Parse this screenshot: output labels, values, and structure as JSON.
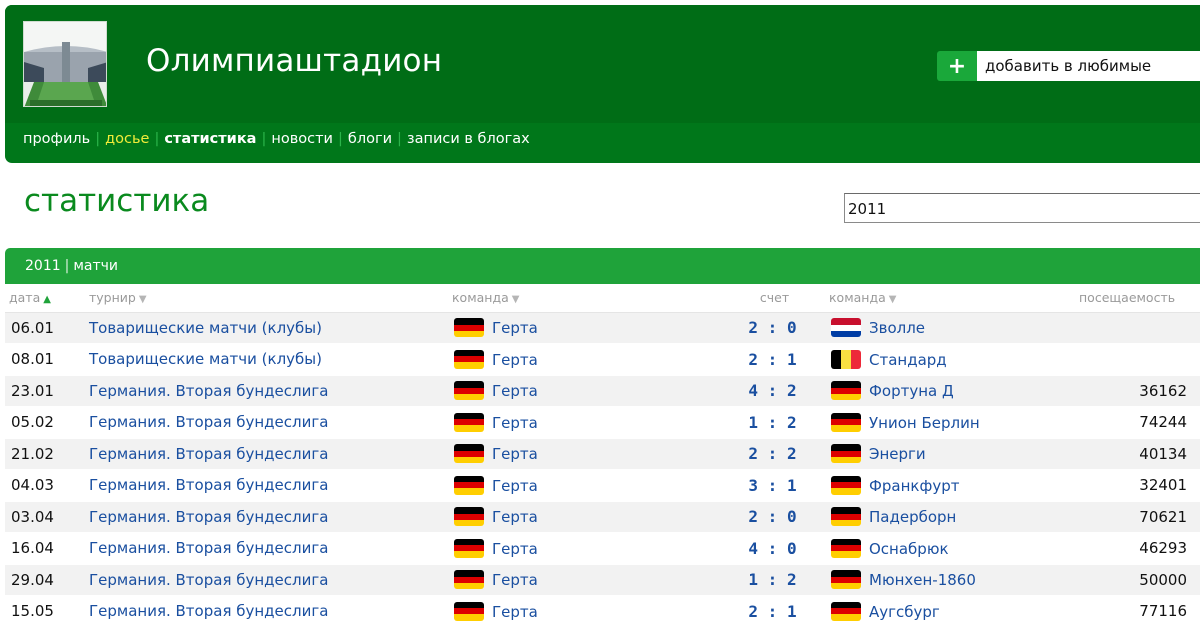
{
  "header": {
    "title": "Олимпиаштадион",
    "favorite_plus": "+",
    "favorite_label": "добавить в любимые"
  },
  "nav": [
    {
      "label": "профиль",
      "state": "normal"
    },
    {
      "label": "досье",
      "state": "highlight"
    },
    {
      "label": "статистика",
      "state": "current"
    },
    {
      "label": "новости",
      "state": "normal"
    },
    {
      "label": "блоги",
      "state": "normal"
    },
    {
      "label": "записи в блогах",
      "state": "normal"
    }
  ],
  "page_title": "статистика",
  "year_select": {
    "value": "2011"
  },
  "table": {
    "caption_year": "2011",
    "caption_sep": "|",
    "caption_section": "матчи",
    "columns": [
      "дата",
      "турнир",
      "команда",
      "счет",
      "команда",
      "посещаемость"
    ],
    "rows": [
      {
        "date": "06.01",
        "tournament": "Товарищеские матчи (клубы)",
        "home": "Герта",
        "home_flag": "de",
        "score": "2 : 0",
        "away": "Зволле",
        "away_flag": "nl",
        "attendance": ""
      },
      {
        "date": "08.01",
        "tournament": "Товарищеские матчи (клубы)",
        "home": "Герта",
        "home_flag": "de",
        "score": "2 : 1",
        "away": "Стандард",
        "away_flag": "be",
        "attendance": ""
      },
      {
        "date": "23.01",
        "tournament": "Германия. Вторая бундеслига",
        "home": "Герта",
        "home_flag": "de",
        "score": "4 : 2",
        "away": "Фортуна Д",
        "away_flag": "de",
        "attendance": "36162"
      },
      {
        "date": "05.02",
        "tournament": "Германия. Вторая бундеслига",
        "home": "Герта",
        "home_flag": "de",
        "score": "1 : 2",
        "away": "Унион Берлин",
        "away_flag": "de",
        "attendance": "74244"
      },
      {
        "date": "21.02",
        "tournament": "Германия. Вторая бундеслига",
        "home": "Герта",
        "home_flag": "de",
        "score": "2 : 2",
        "away": "Энерги",
        "away_flag": "de",
        "attendance": "40134"
      },
      {
        "date": "04.03",
        "tournament": "Германия. Вторая бундеслига",
        "home": "Герта",
        "home_flag": "de",
        "score": "3 : 1",
        "away": "Франкфурт",
        "away_flag": "de",
        "attendance": "32401"
      },
      {
        "date": "03.04",
        "tournament": "Германия. Вторая бундеслига",
        "home": "Герта",
        "home_flag": "de",
        "score": "2 : 0",
        "away": "Падерборн",
        "away_flag": "de",
        "attendance": "70621"
      },
      {
        "date": "16.04",
        "tournament": "Германия. Вторая бундеслига",
        "home": "Герта",
        "home_flag": "de",
        "score": "4 : 0",
        "away": "Оснабрюк",
        "away_flag": "de",
        "attendance": "46293"
      },
      {
        "date": "29.04",
        "tournament": "Германия. Вторая бундеслига",
        "home": "Герта",
        "home_flag": "de",
        "score": "1 : 2",
        "away": "Мюнхен-1860",
        "away_flag": "de",
        "attendance": "50000"
      },
      {
        "date": "15.05",
        "tournament": "Германия. Вторая бундеслига",
        "home": "Герта",
        "home_flag": "de",
        "score": "2 : 1",
        "away": "Аугсбург",
        "away_flag": "de",
        "attendance": "77116"
      }
    ]
  },
  "colors": {
    "header_green": "#006d16",
    "nav_green": "#00771a",
    "table_bar_green": "#1fa33a",
    "link_blue": "#1a4fa0",
    "highlight_yellow": "#f1ec3a"
  }
}
